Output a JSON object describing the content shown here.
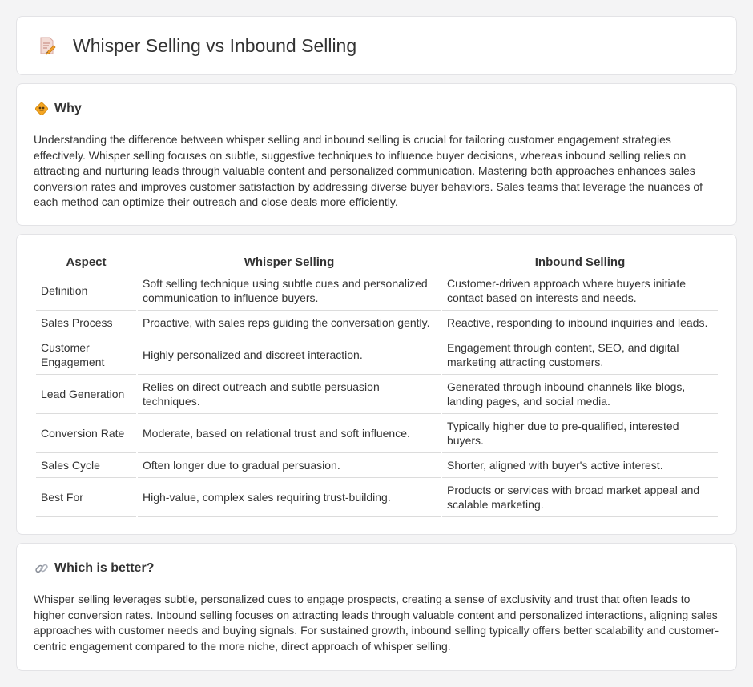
{
  "header": {
    "title": "Whisper Selling vs Inbound Selling",
    "icon": "document-pencil-icon"
  },
  "why": {
    "title": "Why",
    "icon": "diamond-sign-icon",
    "text": "Understanding the difference between whisper selling and inbound selling is crucial for tailoring customer engagement strategies effectively. Whisper selling focuses on subtle, suggestive techniques to influence buyer decisions, whereas inbound selling relies on attracting and nurturing leads through valuable content and personalized communication. Mastering both approaches enhances sales conversion rates and improves customer satisfaction by addressing diverse buyer behaviors. Sales teams that leverage the nuances of each method can optimize their outreach and close deals more efficiently."
  },
  "table": {
    "headers": [
      "Aspect",
      "Whisper Selling",
      "Inbound Selling"
    ],
    "rows": [
      [
        "Definition",
        "Soft selling technique using subtle cues and personalized communication to influence buyers.",
        "Customer-driven approach where buyers initiate contact based on interests and needs."
      ],
      [
        "Sales Process",
        "Proactive, with sales reps guiding the conversation gently.",
        "Reactive, responding to inbound inquiries and leads."
      ],
      [
        "Customer Engagement",
        "Highly personalized and discreet interaction.",
        "Engagement through content, SEO, and digital marketing attracting customers."
      ],
      [
        "Lead Generation",
        "Relies on direct outreach and subtle persuasion techniques.",
        "Generated through inbound channels like blogs, landing pages, and social media."
      ],
      [
        "Conversion Rate",
        "Moderate, based on relational trust and soft influence.",
        "Typically higher due to pre-qualified, interested buyers."
      ],
      [
        "Sales Cycle",
        "Often longer due to gradual persuasion.",
        "Shorter, aligned with buyer's active interest."
      ],
      [
        "Best For",
        "High-value, complex sales requiring trust-building.",
        "Products or services with broad market appeal and scalable marketing."
      ]
    ]
  },
  "better": {
    "title": "Which is better?",
    "icon": "link-icon",
    "text": "Whisper selling leverages subtle, personalized cues to engage prospects, creating a sense of exclusivity and trust that often leads to higher conversion rates. Inbound selling focuses on attracting leads through valuable content and personalized interactions, aligning sales approaches with customer needs and buying signals. For sustained growth, inbound selling typically offers better scalability and customer-centric engagement compared to the more niche, direct approach of whisper selling."
  },
  "colors": {
    "background": "#f4f4f5",
    "card": "#ffffff",
    "text": "#333333",
    "border": "#dcdcdc",
    "accent_orange": "#f0a030"
  }
}
